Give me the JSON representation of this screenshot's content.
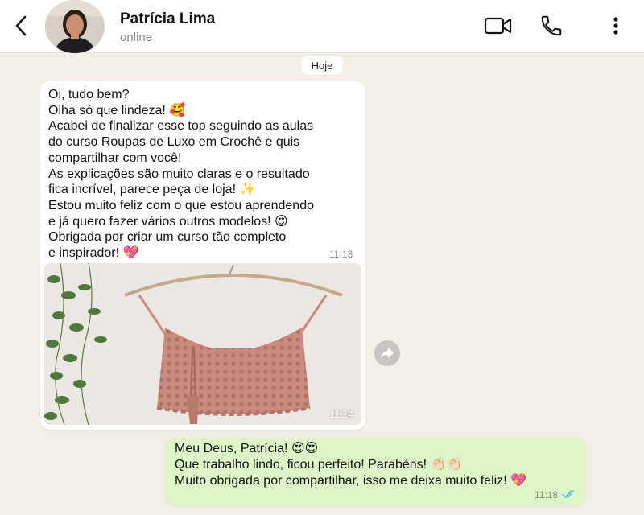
{
  "header": {
    "contact_name": "Patrícia Lima",
    "contact_status": "online"
  },
  "chat": {
    "date_chip": "Hoje",
    "incoming": {
      "lines": [
        "Oi, tudo bem?",
        "Olha só que lindeza! 🥰",
        "Acabei de finalizar esse top seguindo as aulas",
        "do curso Roupas de Luxo em Crochê e quis",
        "compartilhar com você!",
        "As explicações são muito claras e o resultado",
        "fica incrível, parece peça de loja! ✨",
        "Estou muito feliz com o que estou aprendendo",
        "e já quero fazer vários outros modelos! 😍",
        "Obrigada por criar um curso tão completo",
        "e inspirador! 💖"
      ],
      "time": "11:13",
      "photo_time": "11:14"
    },
    "outgoing": {
      "lines": [
        "Meu Deus, Patrícia! 😍😍",
        "Que trabalho lindo, ficou perfeito! Parabéns! 👏🏻👏🏻",
        "Muito obrigada por compartilhar, isso me deixa muito feliz! 💖"
      ],
      "time": "11:18",
      "read_status": "read"
    }
  },
  "colors": {
    "background": "#f3efe8",
    "outgoing_bubble": "#dcf7c5",
    "incoming_bubble": "#ffffff",
    "read_ticks": "#53bdeb",
    "top_color": "#c98a80"
  },
  "icons": {
    "back": "chevron-left-icon",
    "video_call": "video-camera-icon",
    "voice_call": "phone-icon",
    "menu": "more-vertical-icon",
    "forward": "forward-arrow-icon"
  }
}
